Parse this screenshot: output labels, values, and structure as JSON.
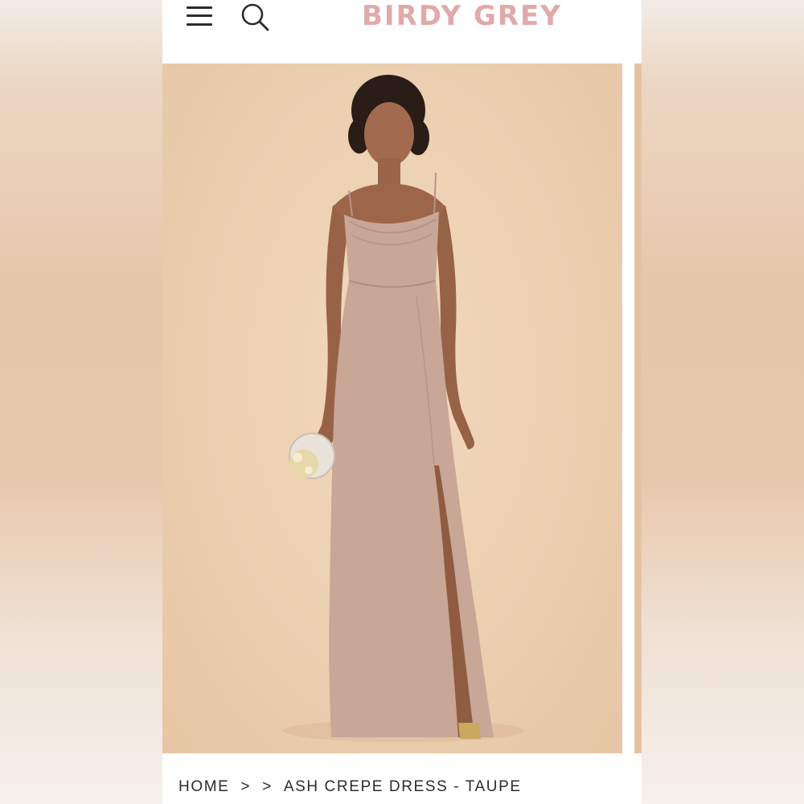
{
  "header": {
    "logo": "BIRDY GREY",
    "menu_icon": "hamburger-menu-icon",
    "search_icon": "search-icon",
    "logo_color": "#e2a9a9"
  },
  "gallery": {
    "image_description": "Model wearing a full-length taupe cowl-neck slip dress with side slit, holding a small clutch"
  },
  "breadcrumb": {
    "home": "HOME",
    "separator_1": ">",
    "separator_2": ">",
    "current": "ASH CREPE DRESS - TAUPE"
  }
}
